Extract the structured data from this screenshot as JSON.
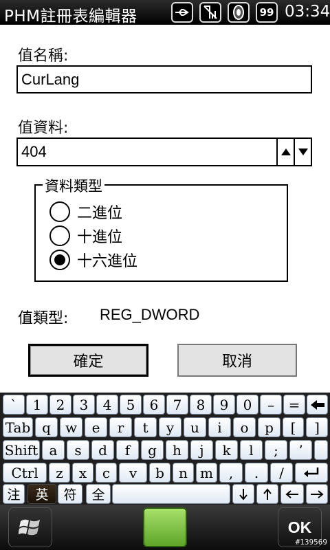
{
  "status_bar": {
    "title": "PHM註冊表編輯器",
    "clock": "03:34",
    "battery": "99",
    "icons": [
      "usb-icon",
      "signal-icon",
      "speaker-icon",
      "battery-icon"
    ]
  },
  "form": {
    "value_name_label": "值名稱:",
    "value_name": "CurLang",
    "value_data_label": "值資料:",
    "value_data": "404",
    "data_type_group": {
      "title": "資料類型",
      "options": [
        {
          "label": "二進位",
          "selected": false
        },
        {
          "label": "十進位",
          "selected": false
        },
        {
          "label": "十六進位",
          "selected": true
        }
      ]
    },
    "value_type_label": "值類型:",
    "value_type": "REG_DWORD",
    "ok_button": "確定",
    "cancel_button": "取消"
  },
  "keyboard": {
    "row1": [
      "`",
      "1",
      "2",
      "3",
      "4",
      "5",
      "6",
      "7",
      "8",
      "9",
      "0",
      "–",
      "="
    ],
    "row2": [
      "Tab",
      "q",
      "w",
      "e",
      "r",
      "t",
      "y",
      "u",
      "i",
      "o",
      "p",
      "[",
      "]"
    ],
    "row3": [
      "Shift",
      "a",
      "s",
      "d",
      "f",
      "g",
      "h",
      "j",
      "k",
      "l",
      ";",
      "’"
    ],
    "row4": [
      "Ctrl",
      "z",
      "x",
      "c",
      "v",
      "b",
      "n",
      "m",
      ",",
      ".",
      "/"
    ],
    "row5": [
      "注",
      "英",
      "符",
      "全"
    ]
  },
  "softbar": {
    "right_label": "OK"
  },
  "watermark": "#139569",
  "colors": {
    "status_bg": "#000000",
    "key_bg": "#eef3fa",
    "keyboard_bg": "#1f1f1f",
    "green_button": "#7cc243"
  }
}
